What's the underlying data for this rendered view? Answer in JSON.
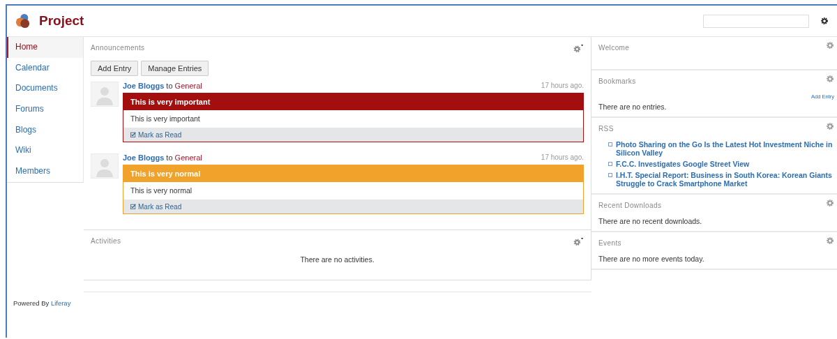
{
  "header": {
    "title": "Project"
  },
  "sidebar": {
    "items": [
      {
        "label": "Home",
        "selected": true
      },
      {
        "label": "Calendar",
        "selected": false
      },
      {
        "label": "Documents",
        "selected": false
      },
      {
        "label": "Forums",
        "selected": false
      },
      {
        "label": "Blogs",
        "selected": false
      },
      {
        "label": "Wiki",
        "selected": false
      },
      {
        "label": "Members",
        "selected": false
      }
    ]
  },
  "announcements": {
    "title": "Announcements",
    "buttons": [
      "Add Entry",
      "Manage Entries"
    ],
    "entries": [
      {
        "author": "Joe Bloggs",
        "to": "to",
        "channel": "General",
        "time": "17 hours ago.",
        "title": "This is very important",
        "body": "This is very important",
        "action": "Mark as Read",
        "color": "#a30f0f"
      },
      {
        "author": "Joe Bloggs",
        "to": "to",
        "channel": "General",
        "time": "17 hours ago.",
        "title": "This is very normal",
        "body": "This is very normal",
        "action": "Mark as Read",
        "color": "#f0a22a"
      }
    ]
  },
  "activities": {
    "title": "Activities",
    "message": "There are no activities."
  },
  "portlets": [
    {
      "title": "Welcome"
    },
    {
      "title": "Bookmarks",
      "add_entry": "Add Entry",
      "message": "There are no entries."
    },
    {
      "title": "RSS",
      "items": [
        "Photo Sharing on the Go Is the Latest Hot Investment Niche in Silicon Valley",
        "F.C.C. Investigates Google Street View",
        "I.H.T. Special Report: Business in South Korea: Korean Giants Struggle to Crack Smartphone Market"
      ]
    },
    {
      "title": "Recent Downloads",
      "message": "There are no recent downloads."
    },
    {
      "title": "Events",
      "message": "There are no more events today."
    }
  ],
  "footer": {
    "text": "Powered By",
    "link": "Liferay"
  }
}
